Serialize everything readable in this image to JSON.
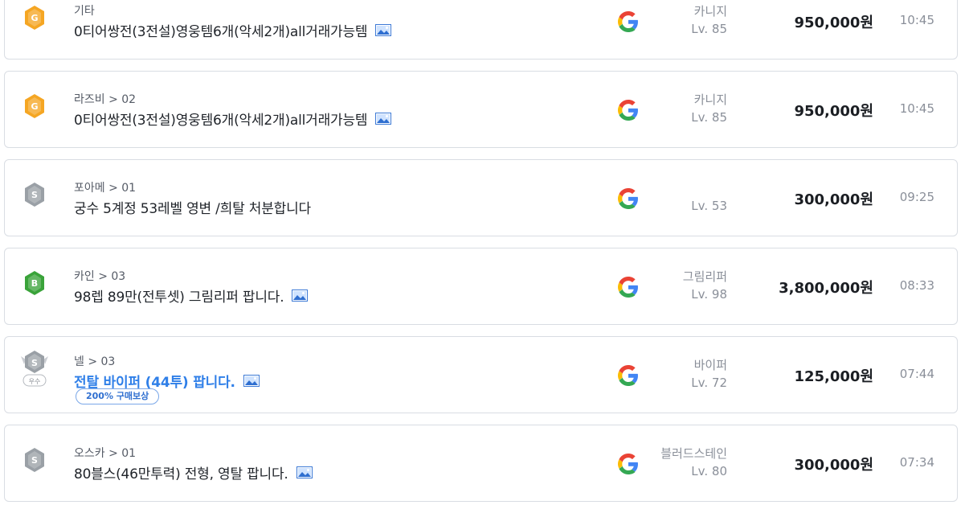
{
  "colors": {
    "gold": "#f5a623",
    "silver": "#9aa0a6",
    "bronze_green": "#3aa33a",
    "title_blue": "#2f7fe8"
  },
  "listings": [
    {
      "grade_icon": "gold-grade-icon",
      "grade_letter": "G",
      "category": "기타",
      "title": "0티어쌍전(3전설)영웅템6개(악세2개)all거래가능템",
      "has_image": true,
      "highlight": false,
      "badge": "",
      "server_icon": "google-icon",
      "char_class": "카니지",
      "char_level": "Lv. 85",
      "price": "950,000원",
      "time": "10:45"
    },
    {
      "grade_icon": "gold-grade-icon",
      "grade_letter": "G",
      "category": "라즈비 > 02",
      "title": "0티어쌍전(3전설)영웅템6개(악세2개)all거래가능템",
      "has_image": true,
      "highlight": false,
      "badge": "",
      "server_icon": "google-icon",
      "char_class": "카니지",
      "char_level": "Lv. 85",
      "price": "950,000원",
      "time": "10:45"
    },
    {
      "grade_icon": "silver-grade-icon",
      "grade_letter": "S",
      "category": "포아메 > 01",
      "title": "궁수 5계정 53레벨 영변 /희탈 처분합니다",
      "has_image": false,
      "highlight": false,
      "badge": "",
      "server_icon": "google-icon",
      "char_class": "",
      "char_level": "Lv. 53",
      "price": "300,000원",
      "time": "09:25"
    },
    {
      "grade_icon": "bronze-grade-icon",
      "grade_letter": "B",
      "category": "카인 > 03",
      "title": "98렙 89만(전투셋) 그림리퍼 팝니다.",
      "has_image": true,
      "highlight": false,
      "badge": "",
      "server_icon": "google-icon",
      "char_class": "그림리퍼",
      "char_level": "Lv. 98",
      "price": "3,800,000원",
      "time": "08:33"
    },
    {
      "grade_icon": "silver-premium-grade-icon",
      "grade_letter": "S",
      "grade_sub": "우수",
      "category": "넬 > 03",
      "title": "전탈 바이퍼 (44투) 팝니다.",
      "has_image": true,
      "highlight": true,
      "badge": "200% 구매보상",
      "server_icon": "google-icon",
      "char_class": "바이퍼",
      "char_level": "Lv. 72",
      "price": "125,000원",
      "time": "07:44"
    },
    {
      "grade_icon": "silver-grade-icon",
      "grade_letter": "S",
      "category": "오스카 > 01",
      "title": "80블스(46만투력) 전형, 영탈 팝니다.",
      "has_image": true,
      "highlight": false,
      "badge": "",
      "server_icon": "google-icon",
      "char_class": "블러드스테인",
      "char_level": "Lv. 80",
      "price": "300,000원",
      "time": "07:34"
    }
  ]
}
